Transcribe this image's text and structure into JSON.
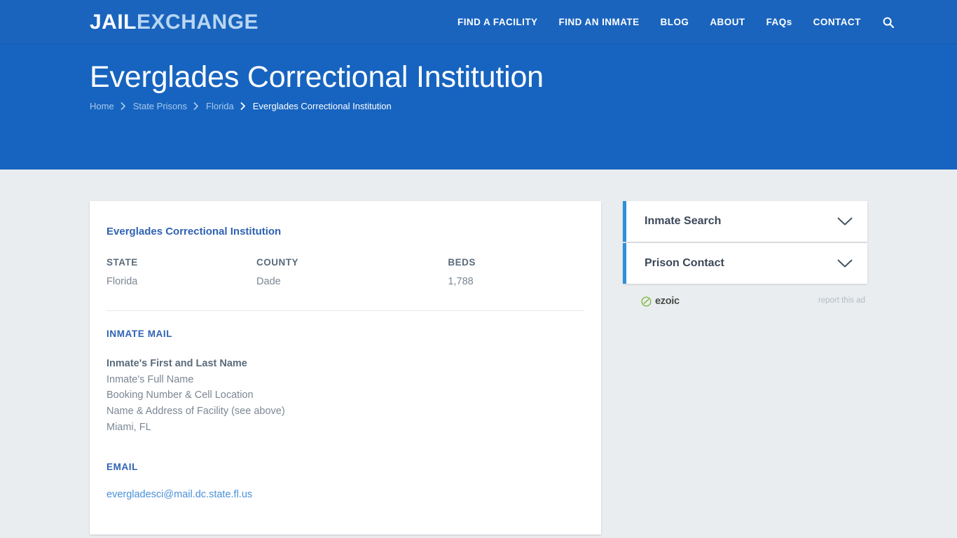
{
  "colors": {
    "header_blue": "#1a64be",
    "hero_blue": "#1764c0",
    "body_gray": "#eaedef",
    "accent_blue": "#2f62b3",
    "sidebar_accent": "#2f8fd8",
    "link_blue": "#4a90d9",
    "ezoic_green": "#7bb93f"
  },
  "header": {
    "brand": {
      "part1": "JAIL",
      "part2": "EXCHANGE"
    },
    "nav": [
      {
        "label": "FIND A FACILITY",
        "name": "nav-find-a-facility"
      },
      {
        "label": "FIND AN INMATE",
        "name": "nav-find-an-inmate"
      },
      {
        "label": "BLOG",
        "name": "nav-blog"
      },
      {
        "label": "ABOUT",
        "name": "nav-about"
      },
      {
        "label": "FAQs",
        "name": "nav-faqs"
      },
      {
        "label": "CONTACT",
        "name": "nav-contact"
      }
    ],
    "search_icon": "search-icon"
  },
  "hero": {
    "title": "Everglades Correctional Institution",
    "breadcrumb": [
      {
        "label": "Home",
        "current": false
      },
      {
        "label": "State Prisons",
        "current": false
      },
      {
        "label": "Florida",
        "current": false
      },
      {
        "label": "Everglades Correctional Institution",
        "current": true
      }
    ],
    "breadcrumb_separator_icon": "chevron-right-icon"
  },
  "main": {
    "facility_name": "Everglades Correctional Institution",
    "stats": [
      {
        "label": "STATE",
        "value": "Florida"
      },
      {
        "label": "COUNTY",
        "value": "Dade"
      },
      {
        "label": "BEDS",
        "value": "1,788"
      }
    ],
    "inmate_mail": {
      "heading": "INMATE MAIL",
      "strong_line": "Inmate's First and Last Name",
      "lines": [
        "Inmate's Full Name",
        "Booking Number & Cell Location",
        "Name & Address of Facility (see above)",
        "Miami, FL"
      ]
    },
    "email": {
      "heading": "EMAIL",
      "address": "evergladesci@mail.dc.state.fl.us"
    }
  },
  "sidebar": {
    "accordions": [
      {
        "title": "Inmate Search",
        "icon": "chevron-down-icon"
      },
      {
        "title": "Prison Contact",
        "icon": "chevron-down-icon"
      }
    ],
    "ad": {
      "provider": "ezoic",
      "provider_icon": "ezoic-logo-icon",
      "report_label": "report this ad"
    }
  }
}
